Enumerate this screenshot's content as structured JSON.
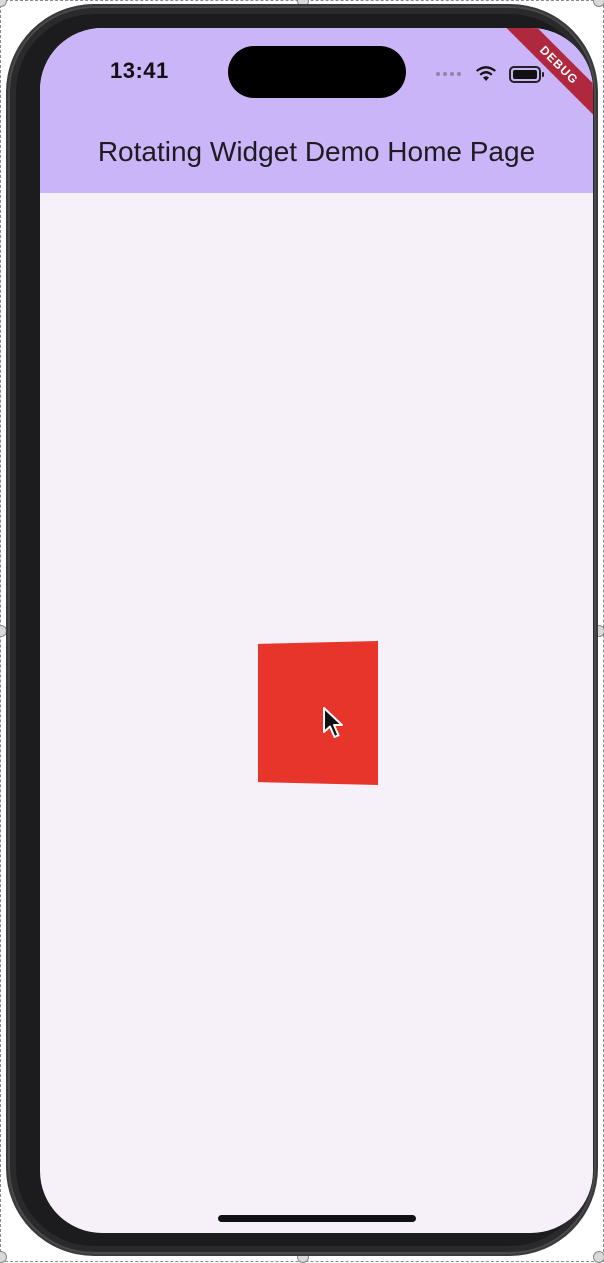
{
  "status_bar": {
    "time": "13:41"
  },
  "app_bar": {
    "title": "Rotating Widget Demo Home Page",
    "color": "#c9b5f8"
  },
  "debug_banner": {
    "label": "DEBUG",
    "color": "#b0283d"
  },
  "content": {
    "background": "#f6f1f9",
    "box_color": "#e8352b"
  },
  "icons": [
    "wifi-icon",
    "battery-icon",
    "signal-icon",
    "cursor-icon"
  ]
}
